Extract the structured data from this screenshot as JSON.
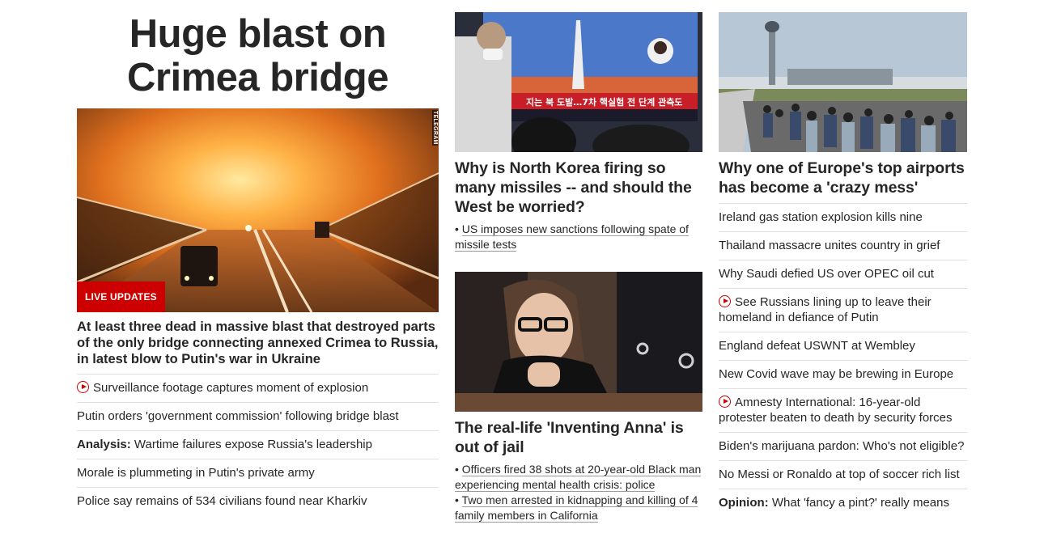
{
  "lead": {
    "headline": "Huge blast on Crimea bridge",
    "headline_line1": "Huge blast on",
    "headline_line2": "Crimea bridge",
    "badge": "LIVE UPDATES",
    "watermark": "TELEGRAM",
    "title": "At least three dead in massive blast that destroyed parts of the only bridge connecting annexed Crimea to Russia, in latest blow to Putin's war in Ukraine",
    "links": [
      {
        "prefix": "",
        "text": "Surveillance footage captures moment of explosion",
        "video": true
      },
      {
        "prefix": "",
        "text": "Putin orders 'government commission' following bridge blast",
        "video": false
      },
      {
        "prefix": "Analysis:",
        "text": "Wartime failures expose Russia's leadership",
        "video": false
      },
      {
        "prefix": "",
        "text": "Morale is plummeting in Putin's private army",
        "video": false
      },
      {
        "prefix": "",
        "text": "Police say remains of 534 civilians found near Kharkiv",
        "video": false
      }
    ]
  },
  "col2": {
    "card1": {
      "title": "Why is North Korea firing so many missiles -- and should the West be worried?",
      "tv_caption": "지는 북 도발…7차 핵실험 전 단계 관측도",
      "sub_links": [
        "US imposes new sanctions following spate of missile tests"
      ]
    },
    "card2": {
      "title": "The real-life 'Inventing Anna' is out of jail",
      "sub_links": [
        "Officers fired 38 shots at 20-year-old Black man experiencing mental health crisis: police",
        "Two men arrested in kidnapping and killing of 4 family members in California"
      ]
    }
  },
  "col3": {
    "card": {
      "title": "Why one of Europe's top airports has become a 'crazy mess'"
    },
    "links": [
      {
        "prefix": "",
        "text": "Ireland gas station explosion kills nine",
        "video": false
      },
      {
        "prefix": "",
        "text": "Thailand massacre unites country in grief",
        "video": false
      },
      {
        "prefix": "",
        "text": "Why Saudi defied US over OPEC oil cut",
        "video": false
      },
      {
        "prefix": "",
        "text": "See Russians lining up to leave their homeland in defiance of Putin",
        "video": true
      },
      {
        "prefix": "",
        "text": "England defeat USWNT at Wembley",
        "video": false
      },
      {
        "prefix": "",
        "text": "New Covid wave may be brewing in Europe",
        "video": false
      },
      {
        "prefix": "",
        "text": "Amnesty International: 16-year-old protester beaten to death by security forces",
        "video": true
      },
      {
        "prefix": "",
        "text": "Biden's marijuana pardon: Who's not eligible?",
        "video": false
      },
      {
        "prefix": "",
        "text": "No Messi or Ronaldo at top of soccer rich list",
        "video": false
      },
      {
        "prefix": "Opinion:",
        "text": "What 'fancy a pint?' really means",
        "video": false
      }
    ]
  },
  "colors": {
    "accent": "#cc0000",
    "text": "#262626",
    "divider": "#e0e0e0"
  },
  "icons": {
    "video": "play-circle-icon"
  }
}
